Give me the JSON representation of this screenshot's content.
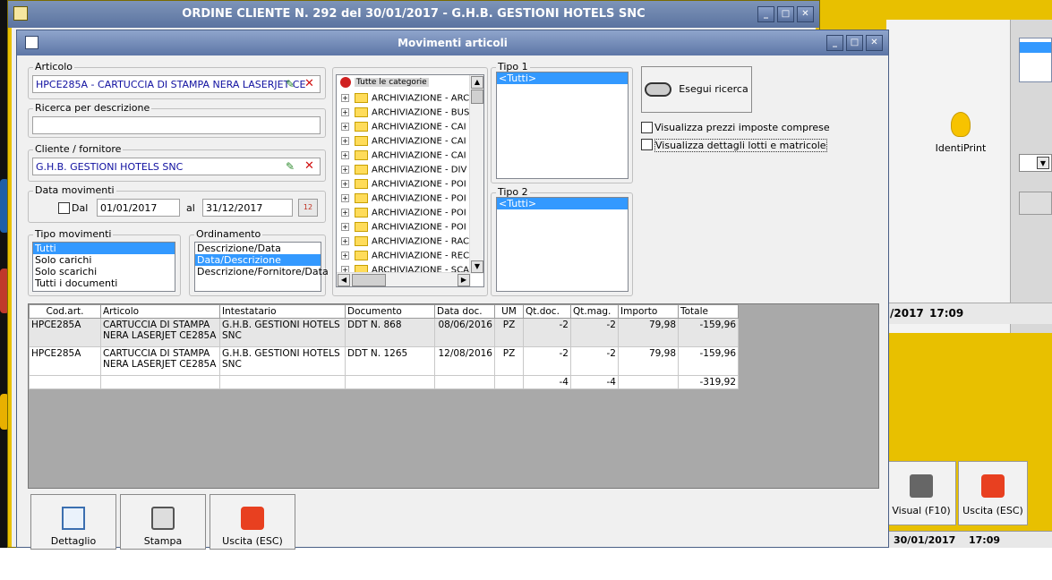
{
  "background_window": {
    "title": "ORDINE CLIENTE N. 292 del 30/01/2017 - G.H.B. GESTIONI HOTELS SNC",
    "buttons": [
      "_",
      "□",
      "✕"
    ]
  },
  "right_app": {
    "identiprint_label": "IdentiPrint",
    "status_date": "/2017",
    "status_time": "17:09",
    "visual_button": "Visual (F10)",
    "exit_button": "Uscita (ESC)",
    "bottom_date": "30/01/2017",
    "bottom_time": "17:09"
  },
  "dialog": {
    "title": "Movimenti articoli",
    "buttons": [
      "_",
      "□",
      "✕"
    ],
    "articolo": {
      "label": "Articolo",
      "value": "HPCE285A - CARTUCCIA DI STAMPA NERA LASERJET CE"
    },
    "ricerca": {
      "label": "Ricerca per descrizione",
      "value": ""
    },
    "cliente": {
      "label": "Cliente / fornitore",
      "value": "G.H.B. GESTIONI HOTELS SNC"
    },
    "data": {
      "label": "Data movimenti",
      "dal_label": "Dal",
      "dal_value": "01/01/2017",
      "al_label": "al",
      "al_value": "31/12/2017",
      "cal_icon": "12"
    },
    "tipo_movimenti": {
      "label": "Tipo movimenti",
      "items": [
        "Tutti",
        "Solo carichi",
        "Solo scarichi",
        "Tutti i documenti"
      ],
      "selected": 0
    },
    "ordinamento": {
      "label": "Ordinamento",
      "items": [
        "Descrizione/Data",
        "Data/Descrizione",
        "Descrizione/Fornitore/Data"
      ],
      "selected": 1
    },
    "categorie": {
      "root": "Tutte le categorie",
      "items": [
        "ARCHIVIAZIONE - ARC",
        "ARCHIVIAZIONE - BUS",
        "ARCHIVIAZIONE - CAI",
        "ARCHIVIAZIONE - CAI",
        "ARCHIVIAZIONE - CAI",
        "ARCHIVIAZIONE - DIV",
        "ARCHIVIAZIONE - POI",
        "ARCHIVIAZIONE - POI",
        "ARCHIVIAZIONE - POI",
        "ARCHIVIAZIONE - POI",
        "ARCHIVIAZIONE - RAC",
        "ARCHIVIAZIONE - REC",
        "ARCHIVIAZIONE - SCA"
      ]
    },
    "tipo1": {
      "label": "Tipo 1",
      "items": [
        "<Tutti>"
      ]
    },
    "tipo2": {
      "label": "Tipo 2",
      "items": [
        "<Tutti>"
      ]
    },
    "search_button": "Esegui ricerca",
    "check_prezzi": "Visualizza prezzi imposte comprese",
    "check_lotti": "Visualizza dettagli lotti e matricole",
    "table": {
      "headers": [
        "Cod.art.",
        "Articolo",
        "Intestatario",
        "Documento",
        "Data doc.",
        "UM",
        "Qt.doc.",
        "Qt.mag.",
        "Importo",
        "Totale"
      ],
      "rows": [
        [
          "HPCE285A",
          "CARTUCCIA DI STAMPA NERA LASERJET CE285A",
          "G.H.B. GESTIONI HOTELS SNC",
          "DDT N. 868",
          "08/06/2016",
          "PZ",
          "-2",
          "-2",
          "79,98",
          "-159,96"
        ],
        [
          "HPCE285A",
          "CARTUCCIA DI STAMPA NERA LASERJET CE285A",
          "G.H.B. GESTIONI HOTELS SNC",
          "DDT N. 1265",
          "12/08/2016",
          "PZ",
          "-2",
          "-2",
          "79,98",
          "-159,96"
        ]
      ],
      "totals": [
        "",
        "",
        "",
        "",
        "",
        "",
        "-4",
        "-4",
        "",
        "-319,92"
      ]
    },
    "bottom_buttons": [
      "Dettaglio",
      "Stampa",
      "Uscita (ESC)"
    ]
  },
  "colors": {
    "title_bar": "#5d76a6",
    "selection": "#3399ff",
    "background_app": "#e8c000",
    "grid_empty": "#a9a9a9"
  }
}
